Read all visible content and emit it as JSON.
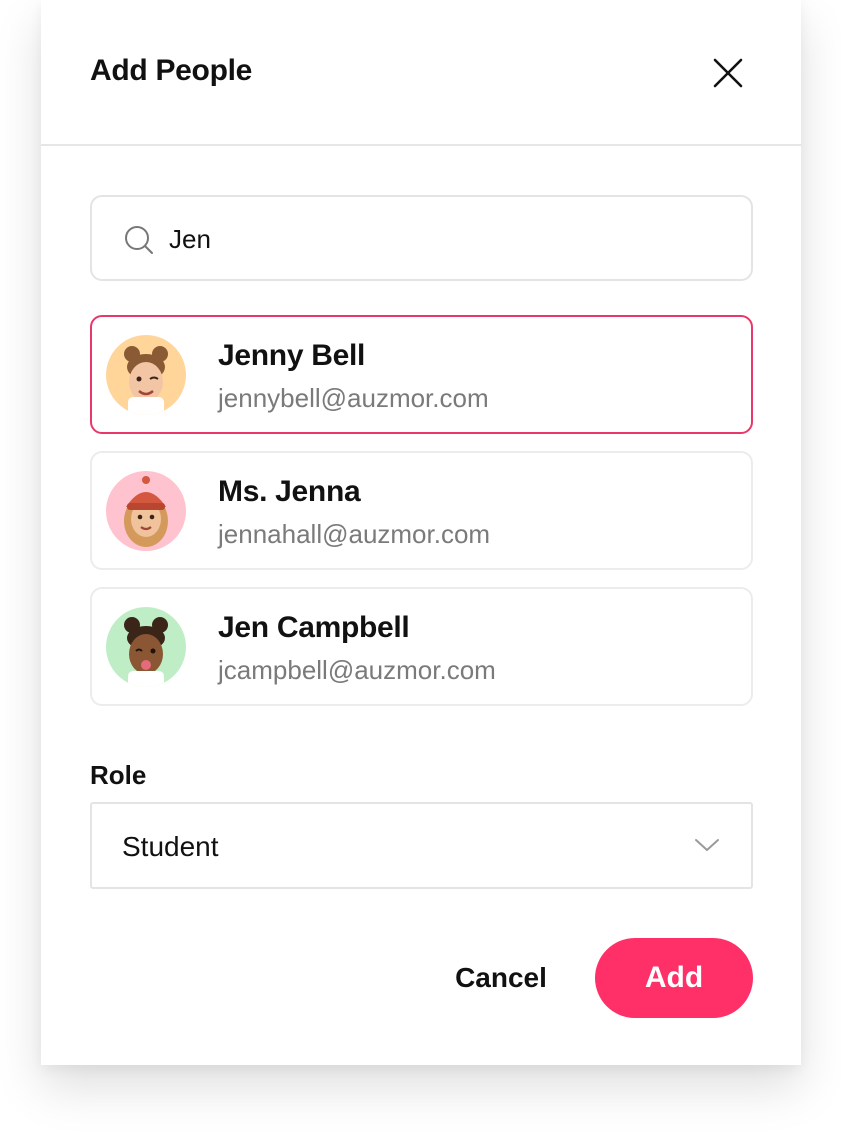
{
  "dialog": {
    "title": "Add People"
  },
  "search": {
    "value": "Jen"
  },
  "results": [
    {
      "name": "Jenny Bell",
      "email": "jennybell@auzmor.com",
      "avatar_bg": "#ffd59a",
      "selected": true
    },
    {
      "name": "Ms. Jenna",
      "email": "jennahall@auzmor.com",
      "avatar_bg": "#ffc2cf",
      "selected": false
    },
    {
      "name": "Jen Campbell",
      "email": "jcampbell@auzmor.com",
      "avatar_bg": "#bfeec6",
      "selected": false
    }
  ],
  "role": {
    "label": "Role",
    "selected": "Student"
  },
  "actions": {
    "cancel_label": "Cancel",
    "add_label": "Add"
  },
  "colors": {
    "accent": "#ff2f67",
    "selected_border": "#e8386a",
    "email_text": "#7a7a7a"
  },
  "icons": {
    "close": "close-icon",
    "search": "search-icon",
    "dropdown": "chevron-down-icon"
  }
}
